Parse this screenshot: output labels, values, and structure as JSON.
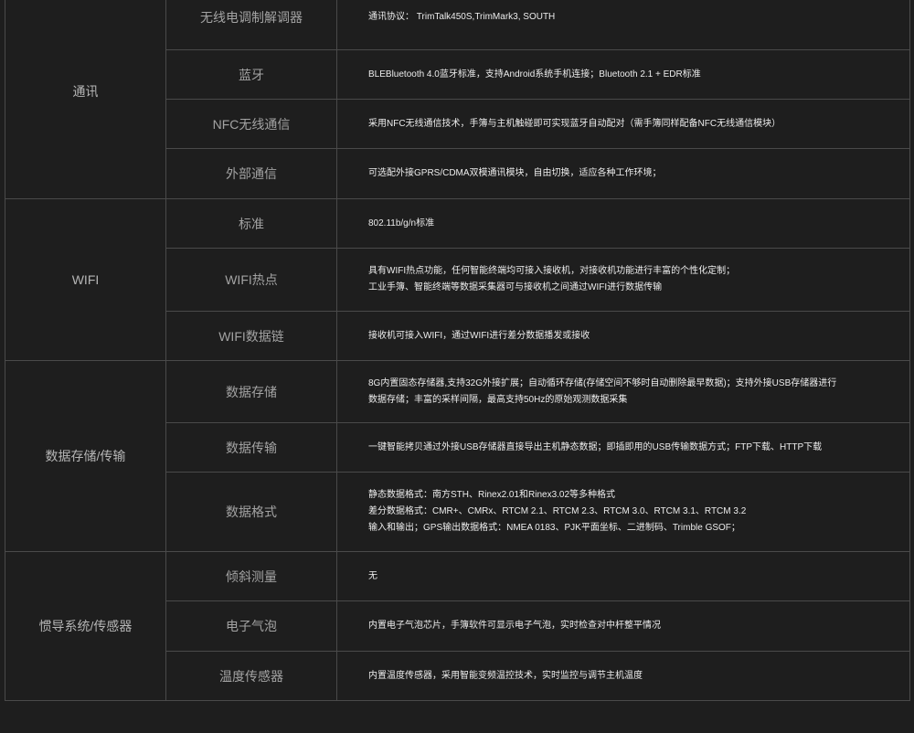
{
  "groups": [
    {
      "category": "通讯",
      "rows": [
        {
          "item": "无线电调制解调器",
          "lines": [
            "通讯协议： TrimTalk450S,TrimMark3, SOUTH"
          ]
        },
        {
          "item": "蓝牙",
          "lines": [
            "BLEBluetooth 4.0蓝牙标准，支持Android系统手机连接；Bluetooth 2.1 + EDR标准"
          ]
        },
        {
          "item": "NFC无线通信",
          "lines": [
            "采用NFC无线通信技术，手簿与主机触碰即可实现蓝牙自动配对（需手簿同样配备NFC无线通信模块）"
          ]
        },
        {
          "item": "外部通信",
          "lines": [
            "可选配外接GPRS/CDMA双模通讯模块，自由切换，适应各种工作环境；"
          ]
        }
      ]
    },
    {
      "category": "WIFI",
      "rows": [
        {
          "item": "标准",
          "lines": [
            "802.11b/g/n标准"
          ]
        },
        {
          "item": "WIFI热点",
          "lines": [
            "具有WIFI热点功能，任何智能终端均可接入接收机，对接收机功能进行丰富的个性化定制；",
            "工业手簿、智能终端等数据采集器可与接收机之间通过WIFI进行数据传输"
          ]
        },
        {
          "item": "WIFI数据链",
          "lines": [
            "接收机可接入WIFI，通过WIFI进行差分数据播发或接收"
          ]
        }
      ]
    },
    {
      "category": "数据存储/传输",
      "rows": [
        {
          "item": "数据存储",
          "lines": [
            "8G内置固态存储器,支持32G外接扩展；自动循环存储(存储空间不够时自动删除最早数据)；支持外接USB存储器进行",
            "数据存储；丰富的采样间隔，最高支持50Hz的原始观测数据采集"
          ]
        },
        {
          "item": "数据传输",
          "lines": [
            "一键智能拷贝通过外接USB存储器直接导出主机静态数据；即插即用的USB传输数据方式；FTP下载、HTTP下载"
          ]
        },
        {
          "item": "数据格式",
          "lines": [
            "静态数据格式：南方STH、Rinex2.01和Rinex3.02等多种格式",
            "差分数据格式：CMR+、CMRx、RTCM 2.1、RTCM 2.3、RTCM 3.0、RTCM 3.1、RTCM 3.2",
            "输入和输出；GPS输出数据格式：NMEA 0183、PJK平面坐标、二进制码、Trimble GSOF；"
          ]
        }
      ]
    },
    {
      "category": "惯导系统/传感器",
      "rows": [
        {
          "item": "倾斜测量",
          "lines": [
            "无"
          ]
        },
        {
          "item": "电子气泡",
          "lines": [
            "内置电子气泡芯片，手簿软件可显示电子气泡，实时检查对中杆整平情况"
          ]
        },
        {
          "item": "温度传感器",
          "lines": [
            "内置温度传感器，采用智能变频温控技术，实时监控与调节主机温度"
          ]
        }
      ]
    }
  ]
}
